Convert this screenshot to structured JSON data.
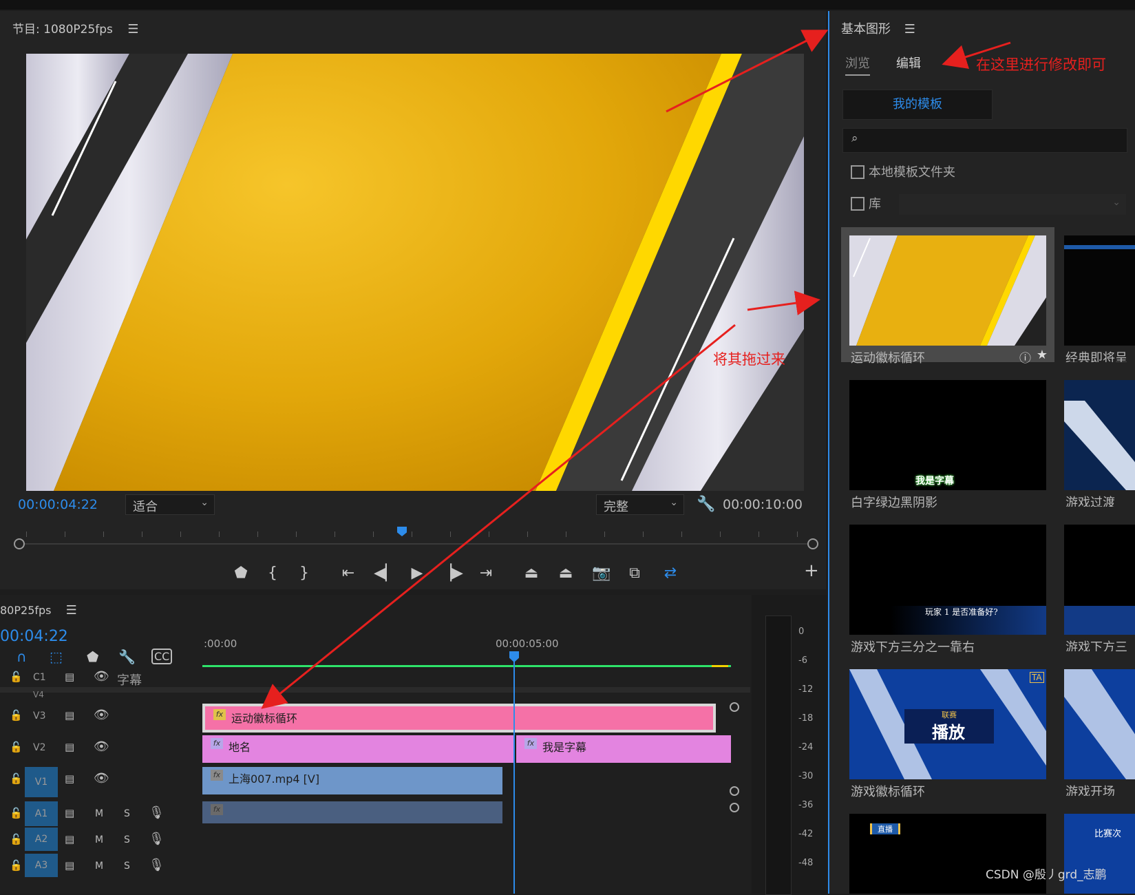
{
  "program_monitor": {
    "title": "节目: 1080P25fps",
    "menu_icon": "☰",
    "current_timecode": "00:00:04:22",
    "fit_value": "适合",
    "quality_value": "完整",
    "duration_timecode": "00:00:10:00"
  },
  "timeline": {
    "title": "80P25fps",
    "menu_icon": "☰",
    "current_timecode": "00:04:22",
    "ruler_labels": [
      ":00:00",
      "00:00:05:00"
    ],
    "tracks": {
      "c1": {
        "label": "C1",
        "name": "字幕"
      },
      "v4": {
        "label": "V4"
      },
      "v3": {
        "label": "V3"
      },
      "v2": {
        "label": "V2"
      },
      "v1": {
        "label": "V1"
      },
      "a1": {
        "label": "A1",
        "m": "M",
        "s": "S"
      },
      "a2": {
        "label": "A2",
        "m": "M",
        "s": "S"
      },
      "a3": {
        "label": "A3",
        "m": "M",
        "s": "S"
      }
    },
    "clips": {
      "v3_clip": "运动徽标循环",
      "v2_clip_a": "地名",
      "v2_clip_b": "我是字幕",
      "v1_clip": "上海007.mp4 [V]"
    },
    "fx_label": "fx"
  },
  "audio_meter": {
    "labels": [
      "0",
      "-6",
      "-12",
      "-18",
      "-24",
      "-30",
      "-36",
      "-42",
      "-48"
    ]
  },
  "essential_graphics": {
    "title": "基本图形",
    "menu_icon": "☰",
    "tab_browse": "浏览",
    "tab_edit": "编辑",
    "my_templates": "我的模板",
    "local_folder_label": "本地模板文件夹",
    "library_label": "库",
    "templates": [
      {
        "name": "运动徽标循环"
      },
      {
        "name": "经典即将呈"
      },
      {
        "name": "白字绿边黑阴影",
        "overlay": "我是字幕"
      },
      {
        "name": "游戏过渡"
      },
      {
        "name": "游戏下方三分之一靠右",
        "overlay": "玩家 1 是否准备好?"
      },
      {
        "name": "游戏下方三"
      },
      {
        "name": "游戏徽标循环",
        "overlay_top": "联赛",
        "overlay": "播放"
      },
      {
        "name": "游戏开场"
      },
      {
        "name": "",
        "overlay": "直播"
      },
      {
        "name": "",
        "overlay": "比赛次"
      }
    ]
  },
  "annotations": {
    "edit_here": "在这里进行修改即可",
    "drag_here": "将其拖过来"
  },
  "watermark": "CSDN @殷丿grd_志鹏",
  "colors": {
    "accent_blue": "#2d8ceb",
    "annotation_red": "#e6201e",
    "clip_pink": "#f571a7",
    "clip_violet": "#e384e0",
    "clip_blue": "#6e96c9",
    "timeline_green": "#2ee36a"
  }
}
